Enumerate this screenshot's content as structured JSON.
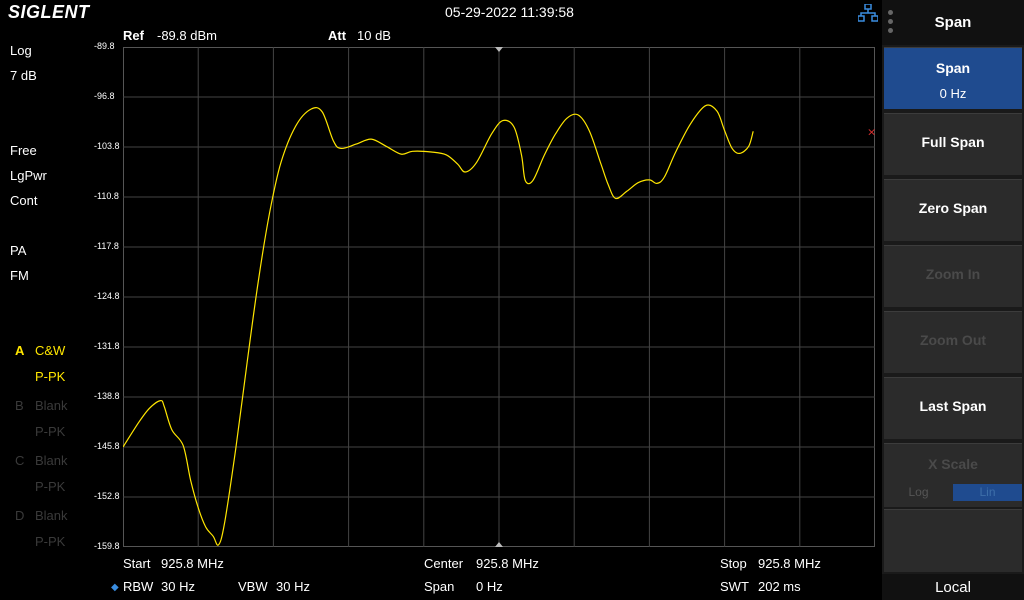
{
  "brand": "SIGLENT",
  "datetime": "05-29-2022 11:39:58",
  "header": {
    "ref_label": "Ref",
    "ref_value": "-89.8 dBm",
    "att_label": "Att",
    "att_value": "10 dB"
  },
  "left_status": {
    "scale": "Log",
    "div": "7 dB",
    "mode1": "Free",
    "mode2": "LgPwr",
    "mode3": "Cont",
    "pa": "PA",
    "fm": "FM"
  },
  "traces": [
    {
      "letter": "A",
      "mode": "C&W",
      "detector": "P-PK",
      "active": true
    },
    {
      "letter": "B",
      "mode": "Blank",
      "detector": "P-PK",
      "active": false
    },
    {
      "letter": "C",
      "mode": "Blank",
      "detector": "P-PK",
      "active": false
    },
    {
      "letter": "D",
      "mode": "Blank",
      "detector": "P-PK",
      "active": false
    }
  ],
  "y_ticks": [
    "-89.8",
    "-96.8",
    "-103.8",
    "-110.8",
    "-117.8",
    "-124.8",
    "-131.8",
    "-138.8",
    "-145.8",
    "-152.8",
    "-159.8"
  ],
  "bottom": {
    "start_label": "Start",
    "start_value": "925.8 MHz",
    "center_label": "Center",
    "center_value": "925.8 MHz",
    "stop_label": "Stop",
    "stop_value": "925.8 MHz",
    "rbw_label": "RBW",
    "rbw_value": "30 Hz",
    "vbw_label": "VBW",
    "vbw_value": "30 Hz",
    "span_label": "Span",
    "span_value": "0 Hz",
    "swt_label": "SWT",
    "swt_value": "202 ms"
  },
  "menu": {
    "title": "Span",
    "items": [
      {
        "label": "Span",
        "sub": "0 Hz",
        "state": "active"
      },
      {
        "label": "Full Span",
        "state": "enabled"
      },
      {
        "label": "Zero Span",
        "state": "enabled"
      },
      {
        "label": "Zoom In",
        "state": "disabled"
      },
      {
        "label": "Zoom Out",
        "state": "disabled"
      },
      {
        "label": "Last Span",
        "state": "enabled"
      },
      {
        "label": "X Scale",
        "state": "disabled"
      }
    ],
    "x_scale_options": [
      "Log",
      "Lin"
    ],
    "local_label": "Local"
  },
  "colors": {
    "trace": "#ffe600",
    "grid": "#444444",
    "active_key": "#1f4b8f"
  },
  "chart_data": {
    "type": "line",
    "ylabel": "",
    "ylim": [
      -159.8,
      -89.8
    ],
    "xlim": [
      0,
      1
    ],
    "series": [
      {
        "points": [
          [
            0.0,
            -145.8
          ],
          [
            0.02,
            -142.5
          ],
          [
            0.035,
            -140.4
          ],
          [
            0.05,
            -139.3
          ],
          [
            0.055,
            -140.2
          ],
          [
            0.065,
            -143.4
          ],
          [
            0.08,
            -145.6
          ],
          [
            0.09,
            -150.5
          ],
          [
            0.1,
            -154.3
          ],
          [
            0.11,
            -157.0
          ],
          [
            0.12,
            -158.3
          ],
          [
            0.127,
            -159.5
          ],
          [
            0.135,
            -156.5
          ],
          [
            0.15,
            -146.0
          ],
          [
            0.165,
            -134.0
          ],
          [
            0.18,
            -122.5
          ],
          [
            0.195,
            -113.0
          ],
          [
            0.21,
            -106.0
          ],
          [
            0.23,
            -100.8
          ],
          [
            0.25,
            -98.5
          ],
          [
            0.265,
            -98.9
          ],
          [
            0.28,
            -103.0
          ],
          [
            0.29,
            -104.0
          ],
          [
            0.31,
            -103.4
          ],
          [
            0.33,
            -102.7
          ],
          [
            0.35,
            -103.7
          ],
          [
            0.37,
            -104.8
          ],
          [
            0.385,
            -104.4
          ],
          [
            0.41,
            -104.5
          ],
          [
            0.43,
            -104.9
          ],
          [
            0.445,
            -106.2
          ],
          [
            0.455,
            -107.3
          ],
          [
            0.47,
            -106.0
          ],
          [
            0.49,
            -102.0
          ],
          [
            0.505,
            -100.1
          ],
          [
            0.52,
            -101.0
          ],
          [
            0.53,
            -105.0
          ],
          [
            0.535,
            -108.5
          ],
          [
            0.545,
            -108.5
          ],
          [
            0.56,
            -105.0
          ],
          [
            0.575,
            -102.0
          ],
          [
            0.59,
            -99.8
          ],
          [
            0.605,
            -99.3
          ],
          [
            0.62,
            -101.5
          ],
          [
            0.635,
            -106.0
          ],
          [
            0.645,
            -109.0
          ],
          [
            0.655,
            -111.0
          ],
          [
            0.67,
            -110.0
          ],
          [
            0.685,
            -108.8
          ],
          [
            0.7,
            -108.4
          ],
          [
            0.71,
            -108.9
          ],
          [
            0.72,
            -108.0
          ],
          [
            0.735,
            -104.5
          ],
          [
            0.755,
            -100.5
          ],
          [
            0.775,
            -98.0
          ],
          [
            0.79,
            -98.8
          ],
          [
            0.8,
            -101.5
          ],
          [
            0.81,
            -104.0
          ],
          [
            0.82,
            -104.7
          ],
          [
            0.832,
            -103.7
          ],
          [
            0.838,
            -101.6
          ]
        ]
      }
    ]
  }
}
